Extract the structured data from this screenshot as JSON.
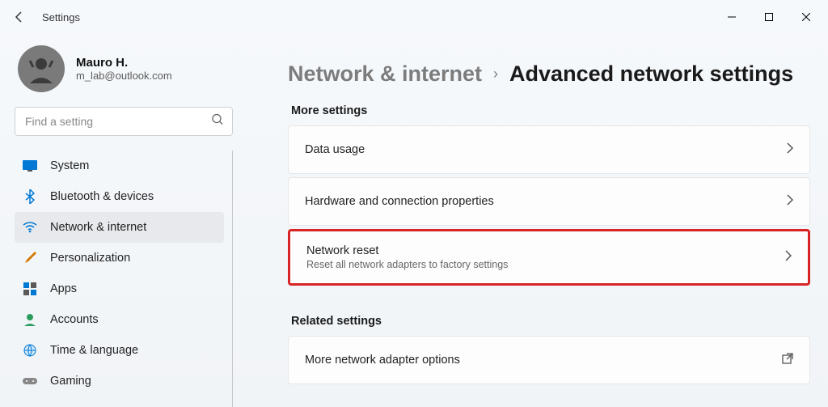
{
  "app": {
    "title": "Settings"
  },
  "user": {
    "name": "Mauro H.",
    "email": "m_lab@outlook.com"
  },
  "search": {
    "placeholder": "Find a setting"
  },
  "sidebar": {
    "items": [
      {
        "label": "System"
      },
      {
        "label": "Bluetooth & devices"
      },
      {
        "label": "Network & internet"
      },
      {
        "label": "Personalization"
      },
      {
        "label": "Apps"
      },
      {
        "label": "Accounts"
      },
      {
        "label": "Time & language"
      },
      {
        "label": "Gaming"
      }
    ]
  },
  "breadcrumb": {
    "parent": "Network & internet",
    "current": "Advanced network settings"
  },
  "sections": {
    "more": {
      "header": "More settings",
      "items": [
        {
          "title": "Data usage",
          "subtitle": ""
        },
        {
          "title": "Hardware and connection properties",
          "subtitle": ""
        },
        {
          "title": "Network reset",
          "subtitle": "Reset all network adapters to factory settings",
          "highlighted": true
        }
      ]
    },
    "related": {
      "header": "Related settings",
      "items": [
        {
          "title": "More network adapter options",
          "subtitle": "",
          "external": true
        }
      ]
    }
  }
}
